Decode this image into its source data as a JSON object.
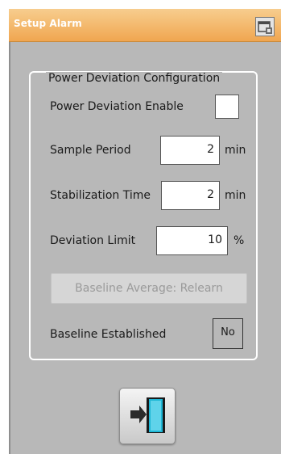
{
  "window": {
    "title": "Setup Alarm"
  },
  "group": {
    "title": "Power Deviation Configuration"
  },
  "enable": {
    "label": "Power Deviation Enable",
    "checked": false
  },
  "sample_period": {
    "label": "Sample Period",
    "value": "2",
    "unit": "min"
  },
  "stabilization_time": {
    "label": "Stabilization Time",
    "value": "2",
    "unit": "min"
  },
  "deviation_limit": {
    "label": "Deviation Limit",
    "value": "10",
    "unit": "%"
  },
  "relearn_button": {
    "label": "Baseline Average: Relearn",
    "enabled": false
  },
  "baseline": {
    "label": "Baseline Established",
    "value": "No"
  },
  "icons": {
    "title_icon": "window-options-icon",
    "exit": "exit-door-icon"
  },
  "colors": {
    "titlebar": "#f0a650",
    "panel": "#b8b8b8",
    "exit_door": "#1fb7d6",
    "exit_arrow": "#2b2b2b"
  }
}
